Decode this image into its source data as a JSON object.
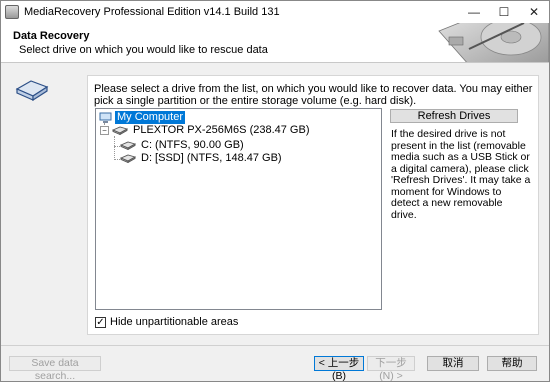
{
  "window": {
    "title": "MediaRecovery Professional Edition v14.1 Build 131",
    "controls": {
      "minimize": "—",
      "maximize": "☐",
      "close": "✕"
    }
  },
  "header": {
    "title": "Data Recovery",
    "subtitle": "Select drive on which you would like to rescue data"
  },
  "main": {
    "intro": "Please select a drive from the list, on which you would like to recover data. You may either pick a single partition or the entire storage volume (e.g. hard disk).",
    "tree": {
      "root": "My Computer",
      "disk": "PLEXTOR PX-256M6S (238.47 GB)",
      "partitions": [
        "C: (NTFS, 90.00 GB)",
        "D: [SSD] (NTFS, 148.47 GB)"
      ]
    },
    "refresh_label": "Refresh Drives",
    "help_text": "If the desired drive is not present in the list (removable media such as a USB Stick or a digital camera), please click 'Refresh Drives'. It may take a moment for Windows to detect a new removable drive.",
    "hide_checkbox": {
      "label": "Hide unpartitionable areas",
      "checked": true
    }
  },
  "footer": {
    "save_label": "Save data search...",
    "back_label": "< 上一步(B)",
    "next_label": "下一步(N) >",
    "cancel_label": "取消",
    "help_label": "帮助"
  },
  "colors": {
    "selection": "#0078d7",
    "background": "#f0f0f0"
  }
}
